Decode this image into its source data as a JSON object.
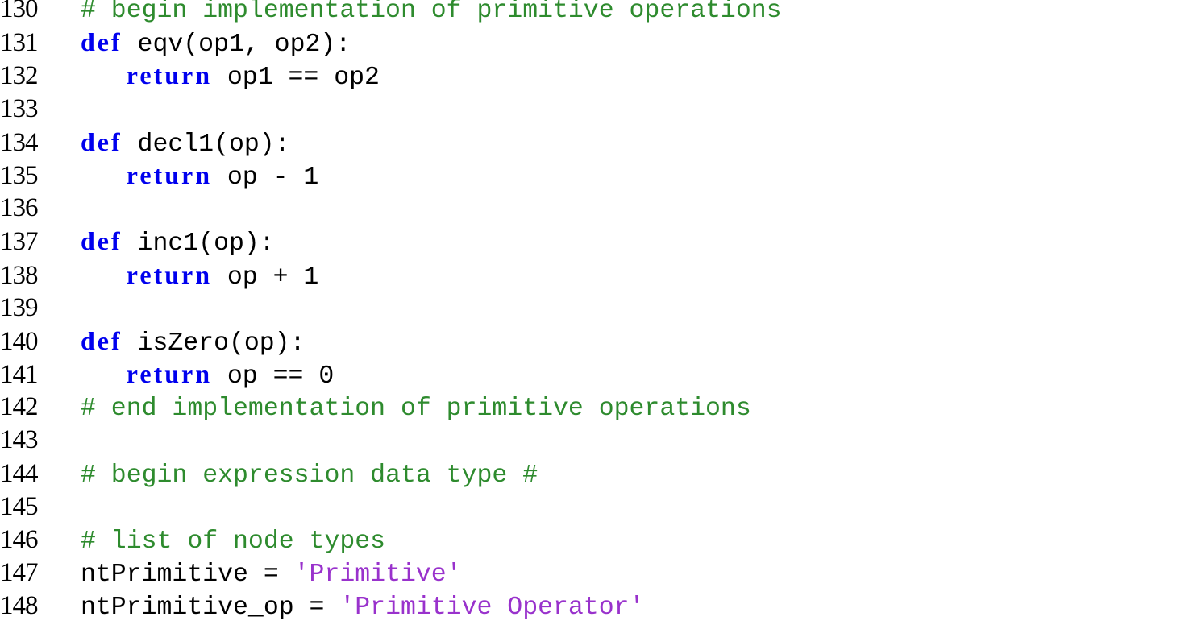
{
  "colors": {
    "keyword": "#0000ee",
    "comment": "#2e8b2e",
    "string": "#9932cc",
    "text": "#000000"
  },
  "lines": [
    {
      "num": "130",
      "tokens": [
        {
          "t": "cm",
          "v": "# begin implementation of primitive operations"
        }
      ]
    },
    {
      "num": "131",
      "tokens": [
        {
          "t": "kw",
          "v": "def"
        },
        {
          "t": "tx",
          "v": " eqv(op1, op2):"
        }
      ]
    },
    {
      "num": "132",
      "tokens": [
        {
          "t": "tx",
          "v": "   "
        },
        {
          "t": "kw",
          "v": "return"
        },
        {
          "t": "tx",
          "v": " op1 == op2"
        }
      ]
    },
    {
      "num": "133",
      "tokens": []
    },
    {
      "num": "134",
      "tokens": [
        {
          "t": "kw",
          "v": "def"
        },
        {
          "t": "tx",
          "v": " decl1(op):"
        }
      ]
    },
    {
      "num": "135",
      "tokens": [
        {
          "t": "tx",
          "v": "   "
        },
        {
          "t": "kw",
          "v": "return"
        },
        {
          "t": "tx",
          "v": " op - 1"
        }
      ]
    },
    {
      "num": "136",
      "tokens": []
    },
    {
      "num": "137",
      "tokens": [
        {
          "t": "kw",
          "v": "def"
        },
        {
          "t": "tx",
          "v": " inc1(op):"
        }
      ]
    },
    {
      "num": "138",
      "tokens": [
        {
          "t": "tx",
          "v": "   "
        },
        {
          "t": "kw",
          "v": "return"
        },
        {
          "t": "tx",
          "v": " op + 1"
        }
      ]
    },
    {
      "num": "139",
      "tokens": []
    },
    {
      "num": "140",
      "tokens": [
        {
          "t": "kw",
          "v": "def"
        },
        {
          "t": "tx",
          "v": " isZero(op):"
        }
      ]
    },
    {
      "num": "141",
      "tokens": [
        {
          "t": "tx",
          "v": "   "
        },
        {
          "t": "kw",
          "v": "return"
        },
        {
          "t": "tx",
          "v": " op == 0"
        }
      ]
    },
    {
      "num": "142",
      "tokens": [
        {
          "t": "cm",
          "v": "# end implementation of primitive operations"
        }
      ]
    },
    {
      "num": "143",
      "tokens": []
    },
    {
      "num": "144",
      "tokens": [
        {
          "t": "cm",
          "v": "# begin expression data type #"
        }
      ]
    },
    {
      "num": "145",
      "tokens": []
    },
    {
      "num": "146",
      "tokens": [
        {
          "t": "cm",
          "v": "# list of node types"
        }
      ]
    },
    {
      "num": "147",
      "tokens": [
        {
          "t": "tx",
          "v": "ntPrimitive = "
        },
        {
          "t": "st",
          "v": "'Primitive'"
        }
      ]
    },
    {
      "num": "148",
      "tokens": [
        {
          "t": "tx",
          "v": "ntPrimitive_op = "
        },
        {
          "t": "st",
          "v": "'Primitive Operator'"
        }
      ]
    }
  ]
}
